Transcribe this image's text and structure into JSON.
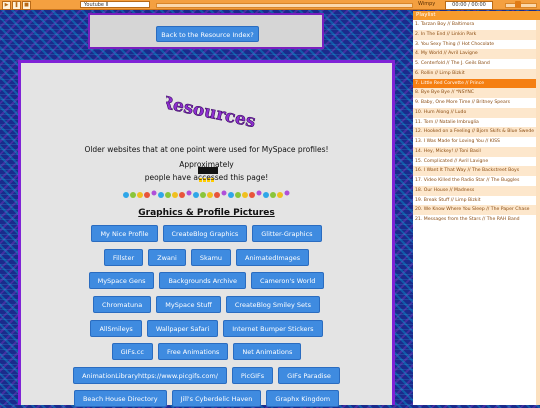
{
  "player": {
    "title": "Youtube II",
    "label": "Wimpy",
    "time": "00:00 / 00:00"
  },
  "banner": {
    "back_button": "Back to the Resource Index?"
  },
  "main": {
    "logo_text": "Resources!",
    "intro": "Older websites that at one point were used for MySpace profiles!",
    "approx": "Approximately",
    "accessed": "people have accessed this page!",
    "section_title": "Graphics & Profile Pictures",
    "rows": [
      [
        "My Nice Profile",
        "CreateBlog Graphics",
        "Glitter-Graphics"
      ],
      [
        "Fillster",
        "Zwani",
        "Skamu",
        "AnimatedImages"
      ],
      [
        "MySpace Gens",
        "Backgrounds Archive",
        "Cameron's World"
      ],
      [
        "Chromatuna",
        "MySpace Stuff",
        "CreateBlog Smiley Sets"
      ],
      [
        "AllSmileys",
        "Wallpaper Safari",
        "Internet Bumper Stickers"
      ],
      [
        "GIFs.cc",
        "Free Animations",
        "Net Animations"
      ],
      [
        "AnimationLibraryhttps://www.picgifs.com/",
        "PicGIFs",
        "GIFs Paradise"
      ],
      [
        "Beach House Directory",
        "Jill's Cyberdelic Haven",
        "Graphx Kingdom"
      ]
    ]
  },
  "playlist": {
    "header": "Playlist",
    "active_index": 6,
    "items": [
      "1. Tarzan Boy // Baltimora",
      "2. In The End // Linkin Park",
      "3. You Sexy Thing // Hot Chocolate",
      "4. My World // Avril Lavigne",
      "5. Centerfold // The J. Geils Band",
      "6. Rollin // Limp Bizkit",
      "7. Little Red Corvette // Prince",
      "8. Bye Bye Bye // *NSYNC",
      "9. Baby, One More Time // Britney Spears",
      "10. Hum Along // Ludo",
      "11. Torn // Natalie Imbruglia",
      "12. Hooked on a Feeling // Bjorn Skifs & Blue Swede",
      "13. I Was Made for Loving You // KISS",
      "14. Hey, Mickey! // Toni Basil",
      "15. Complicated // Avril Lavigne",
      "16. I Want It That Way // The Backstreet Boys",
      "17. Video Killed the Radio Star // The Buggles",
      "18. Our House // Madness",
      "19. Break Stuff // Limp Bizkit",
      "20. We Know Where You Sleep // The Paper Chase",
      "21. Messages from the Stars // The RAH Band"
    ]
  },
  "colors": {
    "accent_orange": "#f79b2c",
    "button_blue": "#3f8be0",
    "frame_purple": "#7f22d6"
  }
}
